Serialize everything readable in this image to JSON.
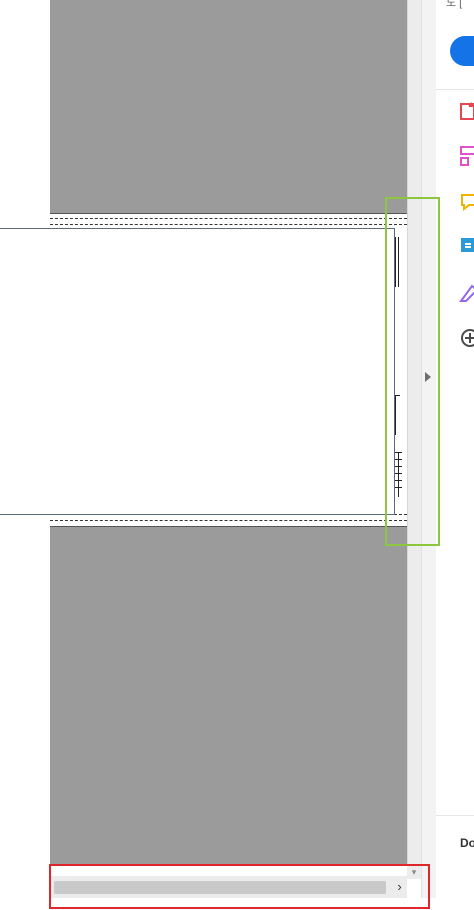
{
  "tools_pane": {
    "top_text": "도 [",
    "bottom_text": "Do",
    "icons": [
      {
        "name": "export-pdf-icon",
        "color": "#e34850"
      },
      {
        "name": "organize-pages-icon",
        "color": "#e052c6"
      },
      {
        "name": "comment-icon",
        "color": "#f0b400"
      },
      {
        "name": "edit-pdf-icon",
        "color": "#2d9ad8"
      },
      {
        "name": "fill-sign-icon",
        "color": "#9266f0"
      },
      {
        "name": "more-tools-icon",
        "color": "#4b4b4b"
      }
    ],
    "accent": "#1473e6"
  },
  "hscroll": {
    "right_arrow": "›"
  },
  "vscroll": {
    "down_arrow": "▾"
  },
  "highlights": {
    "green": "#8dc63f",
    "red": "#e0262b"
  }
}
